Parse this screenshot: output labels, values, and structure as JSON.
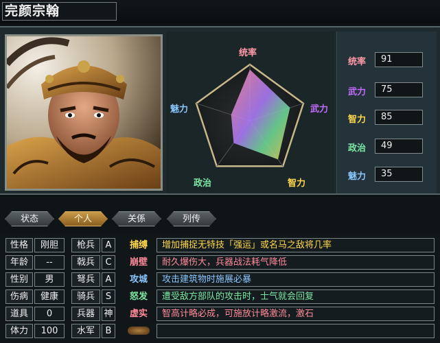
{
  "general": {
    "name": "完颜宗翰"
  },
  "radar_labels": {
    "top": "统率",
    "right": "武力",
    "bottom_right": "智力",
    "bottom_left": "政治",
    "left": "魅力"
  },
  "radar_colors": {
    "top": "#ff9aa6",
    "right": "#c36cff",
    "bottom_right": "#ffd84a",
    "bottom_left": "#7ce8a4",
    "left": "#8ac6ff"
  },
  "stats": [
    {
      "label": "统率",
      "value": "91",
      "color": "#ff9aa6",
      "num": 91
    },
    {
      "label": "武力",
      "value": "75",
      "color": "#c36cff",
      "num": 75
    },
    {
      "label": "智力",
      "value": "85",
      "color": "#ffd84a",
      "num": 85
    },
    {
      "label": "政治",
      "value": "49",
      "color": "#7ce8a4",
      "num": 49
    },
    {
      "label": "魅力",
      "value": "35",
      "color": "#8ac6ff",
      "num": 35
    }
  ],
  "tabs": [
    {
      "label": "状态",
      "active": false
    },
    {
      "label": "个人",
      "active": true
    },
    {
      "label": "关係",
      "active": false
    },
    {
      "label": "列传",
      "active": false
    }
  ],
  "personal": [
    {
      "label": "性格",
      "value": "刚胆"
    },
    {
      "label": "年龄",
      "value": "--"
    },
    {
      "label": "性别",
      "value": "男"
    },
    {
      "label": "伤病",
      "value": "健康"
    },
    {
      "label": "道具",
      "value": "0"
    },
    {
      "label": "体力",
      "value": "100"
    }
  ],
  "aptitudes": [
    {
      "label": "枪兵",
      "grade": "A"
    },
    {
      "label": "戟兵",
      "grade": "C"
    },
    {
      "label": "弩兵",
      "grade": "A"
    },
    {
      "label": "骑兵",
      "grade": "S"
    },
    {
      "label": "兵器",
      "grade": "神"
    },
    {
      "label": "水军",
      "grade": "B"
    }
  ],
  "skills": [
    {
      "name": "捕缚",
      "color": "#ffd84a",
      "desc": "增加捕捉无特技「强运」或名马之敌将几率"
    },
    {
      "name": "崩壁",
      "color": "#ff8a9a",
      "desc": "耐久爆伤大，兵器战法耗气降低"
    },
    {
      "name": "攻城",
      "color": "#8ac6ff",
      "desc": "攻击建筑物时施展必暴"
    },
    {
      "name": "怒发",
      "color": "#7ce8a4",
      "desc": "遭受敌方部队的攻击时，士气就会回复"
    },
    {
      "name": "虚实",
      "color": "#ff8a9a",
      "desc": "智高计略必成，可施放计略激流，激石"
    },
    {
      "name": "",
      "color": "#b07a3a",
      "desc": ""
    }
  ]
}
